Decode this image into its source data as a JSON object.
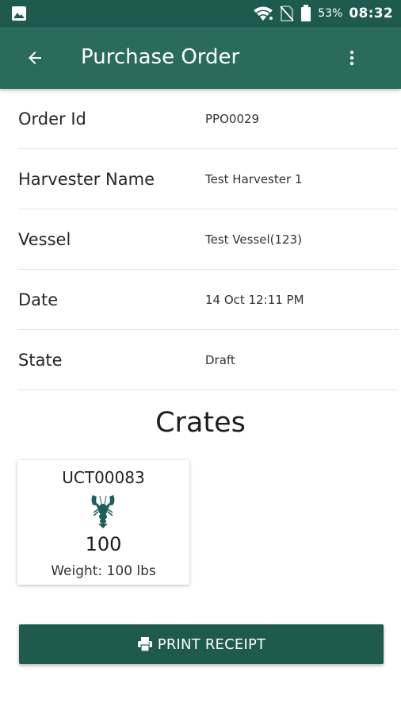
{
  "status_bar": {
    "battery_percent": "53%",
    "time": "08:32",
    "icons": [
      "image-notification-icon",
      "wifi-icon",
      "no-sim-icon",
      "battery-icon"
    ]
  },
  "app_bar": {
    "title": "Purchase Order",
    "back_icon": "arrow-back-icon",
    "menu_icon": "more-vert-icon"
  },
  "details": [
    {
      "label": "Order Id",
      "value": "PPO0029"
    },
    {
      "label": "Harvester Name",
      "value": "Test Harvester 1"
    },
    {
      "label": "Vessel",
      "value": "Test Vessel(123)"
    },
    {
      "label": "Date",
      "value": "14 Oct 12:11 PM"
    },
    {
      "label": "State",
      "value": "Draft"
    }
  ],
  "crates_section": {
    "title": "Crates",
    "crates": [
      {
        "id": "UCT00083",
        "count": "100",
        "weight": "Weight: 100 lbs",
        "icon": "lobster-icon"
      }
    ]
  },
  "actions": {
    "print_label": "PRINT RECEIPT",
    "print_icon": "printer-icon"
  },
  "colors": {
    "status_bar": "#1e5a4e",
    "app_bar": "#2a6b5e",
    "button": "#1e5a4e",
    "lobster": "#1f5e5a"
  }
}
